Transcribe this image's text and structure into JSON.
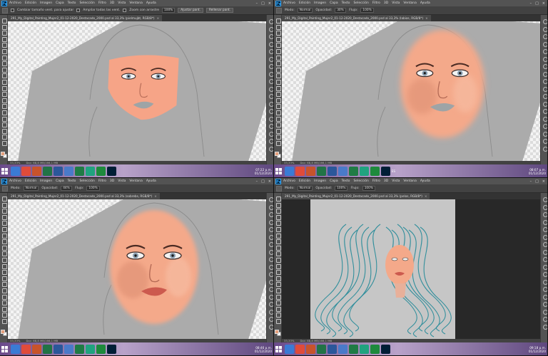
{
  "colors": {
    "ui_bg": "#535353",
    "options_bg": "#424242",
    "canvas_gray": "#ababab",
    "skin": "#f4a98a",
    "skin_shadow": "#d7876c",
    "lips": "#cc5a4e",
    "hair_line": "#2a8c9a",
    "taskbar_accent": "#8e6bb0"
  },
  "menus": [
    "Archivo",
    "Edición",
    "Imagen",
    "Capa",
    "Texto",
    "Selección",
    "Filtro",
    "3D",
    "Vista",
    "Ventana",
    "Ayuda"
  ],
  "taskbar_apps": [
    {
      "name": "file-explorer-icon",
      "color": "#3a7bd5"
    },
    {
      "name": "chrome-icon",
      "color": "#e04b3a"
    },
    {
      "name": "powerpoint-icon",
      "color": "#c8532b"
    },
    {
      "name": "excel-icon",
      "color": "#217346"
    },
    {
      "name": "word-icon",
      "color": "#2b579a"
    },
    {
      "name": "files-icon",
      "color": "#4a7ac9"
    },
    {
      "name": "sheets-icon",
      "color": "#1f7b45"
    },
    {
      "name": "app-teal-icon",
      "color": "#20a37f"
    },
    {
      "name": "app-green-icon",
      "color": "#1d8a3c"
    },
    {
      "name": "photoshop-icon",
      "color": "#001e36"
    }
  ],
  "panels": [
    {
      "id": "p0",
      "opts": [
        {
          "type": "tool",
          "label": ""
        },
        {
          "type": "check",
          "label": "Cambiar tamaño vent. para ajustar"
        },
        {
          "type": "check",
          "label": "Ampliar todas las vent."
        },
        {
          "type": "check",
          "label": "Zoom con arrastre"
        },
        {
          "type": "field",
          "label": "100%"
        },
        {
          "type": "button",
          "label": "Ajustar pant."
        },
        {
          "type": "button",
          "label": "Rellenar pant."
        }
      ],
      "doc_tab": "291_My_Digital_Painting_Mujer2_01-12-2020_Destacado_2000.psd al 33,3% (pielmujbt, RGB/8*)",
      "status": {
        "zoom": "33,33%",
        "doc": "Doc: 68,8 MB/166,1 MB"
      },
      "clock": {
        "time": "07:22 p.m.",
        "date": "01/12/2020"
      },
      "tray": "",
      "stage": 1
    },
    {
      "id": "p1",
      "opts": [
        {
          "type": "tool",
          "label": ""
        },
        {
          "type": "field",
          "label": "Modo:"
        },
        {
          "type": "field",
          "label": "Normal"
        },
        {
          "type": "field",
          "label": "Opacidad:"
        },
        {
          "type": "field",
          "label": "30%"
        },
        {
          "type": "field",
          "label": "Flujo:"
        },
        {
          "type": "field",
          "label": "100%"
        }
      ],
      "doc_tab": "291_My_Digital_Painting_Mujer2_01-12-2020_Destacado_2000.psd al 33,3% (labios, RGB/8*)",
      "status": {
        "zoom": "33,33%",
        "doc": "Doc: 68,8 MB/166,1 MB"
      },
      "clock": {
        "time": "08:07 p.m.",
        "date": "01/12/2020"
      },
      "tray": "ES",
      "stage": 2
    },
    {
      "id": "p2",
      "opts": [
        {
          "type": "tool",
          "label": ""
        },
        {
          "type": "field",
          "label": "Modo:"
        },
        {
          "type": "field",
          "label": "Normal"
        },
        {
          "type": "field",
          "label": "Opacidad:"
        },
        {
          "type": "field",
          "label": "44%"
        },
        {
          "type": "field",
          "label": "Flujo:"
        },
        {
          "type": "field",
          "label": "100%"
        }
      ],
      "doc_tab": "291_My_Digital_Painting_Mujer2_01-12-2020_Destacado_2000.psd al 33,3% (sobrebs, RGB/8*)",
      "status": {
        "zoom": "33,33%",
        "doc": "Doc: 68,8 MB/166,1 MB"
      },
      "clock": {
        "time": "08:46 p.m.",
        "date": "01/12/2020"
      },
      "tray": "",
      "stage": 3
    },
    {
      "id": "p3",
      "opts": [
        {
          "type": "tool",
          "label": ""
        },
        {
          "type": "field",
          "label": "Modo:"
        },
        {
          "type": "field",
          "label": "Normal"
        },
        {
          "type": "field",
          "label": "Opacidad:"
        },
        {
          "type": "field",
          "label": "100%"
        },
        {
          "type": "field",
          "label": "Flujo:"
        },
        {
          "type": "field",
          "label": "100%"
        }
      ],
      "doc_tab": "291_My_Digital_Painting_Mujer2_01-12-2020_Destacado_2000.psd al 33,3% (pelos, RGB/8*)",
      "status": {
        "zoom": "33,33%",
        "doc": "Doc: 68,8 MB/166,1 MB"
      },
      "clock": {
        "time": "09:18 p.m.",
        "date": "01/12/2020"
      },
      "tray": "",
      "stage": 4
    }
  ]
}
